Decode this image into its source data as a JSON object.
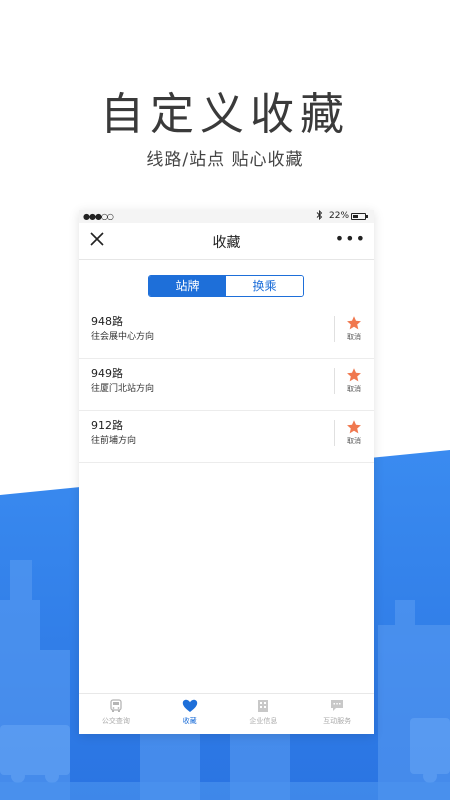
{
  "hero": {
    "title": "自定义收藏",
    "subtitle": "线路/站点   贴心收藏"
  },
  "status_bar": {
    "signal": "●●●○○",
    "battery": "22%"
  },
  "nav": {
    "title": "收藏",
    "close_icon": "close-icon",
    "more_icon": "more-icon",
    "more_label": "•••"
  },
  "segment": {
    "tabs": [
      {
        "label": "站牌",
        "active": true
      },
      {
        "label": "换乘",
        "active": false
      }
    ]
  },
  "favorites": [
    {
      "route": "948路",
      "direction": "往会展中心方向",
      "action": "取消"
    },
    {
      "route": "949路",
      "direction": "往厦门北站方向",
      "action": "取消"
    },
    {
      "route": "912路",
      "direction": "往前埔方向",
      "action": "取消"
    }
  ],
  "tabbar": {
    "items": [
      {
        "label": "公交查询",
        "icon": "bus-icon"
      },
      {
        "label": "收藏",
        "icon": "heart-icon"
      },
      {
        "label": "企业信息",
        "icon": "building-icon"
      },
      {
        "label": "互动服务",
        "icon": "chat-icon"
      }
    ]
  },
  "colors": {
    "accent": "#1e6fd9",
    "star": "#f0784f",
    "background_blue": "#2f7fea"
  }
}
